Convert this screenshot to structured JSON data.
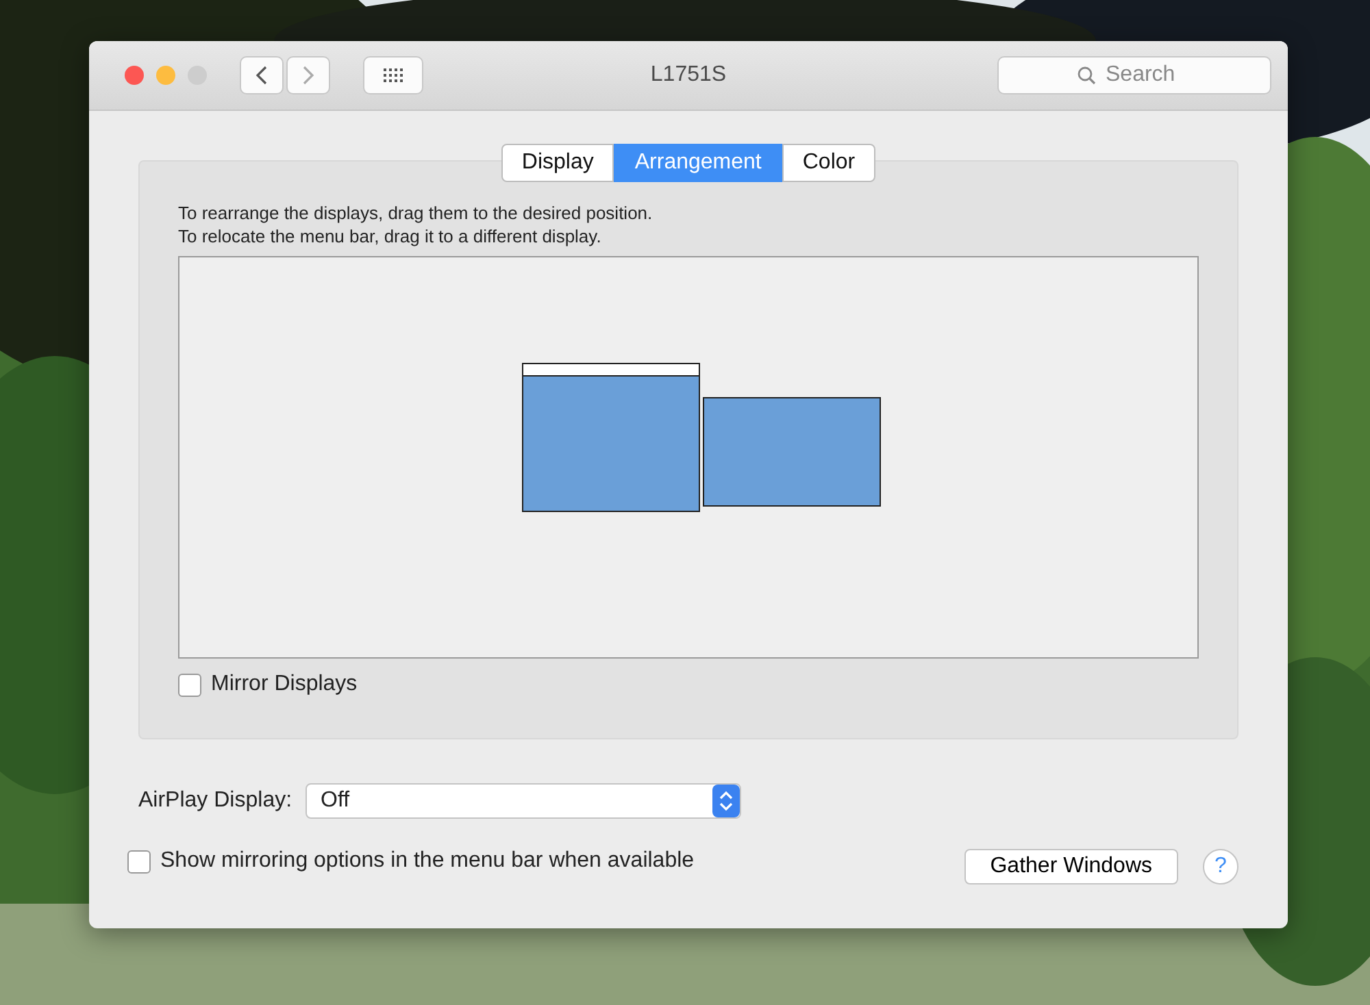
{
  "window": {
    "title": "L1751S"
  },
  "search": {
    "placeholder": "Search"
  },
  "tabs": [
    {
      "label": "Display",
      "selected": false
    },
    {
      "label": "Arrangement",
      "selected": true
    },
    {
      "label": "Color",
      "selected": false
    }
  ],
  "instructions": [
    "To rearrange the displays, drag them to the desired position.",
    "To relocate the menu bar, drag it to a different display."
  ],
  "displays": [
    {
      "menu_bar": true
    },
    {
      "menu_bar": false
    }
  ],
  "mirror_displays": {
    "label": "Mirror Displays",
    "checked": false
  },
  "airplay": {
    "label": "AirPlay Display:",
    "value": "Off"
  },
  "show_mirroring": {
    "label": "Show mirroring options in the menu bar when available",
    "checked": false
  },
  "buttons": [
    "Gather Windows"
  ],
  "help": "?"
}
